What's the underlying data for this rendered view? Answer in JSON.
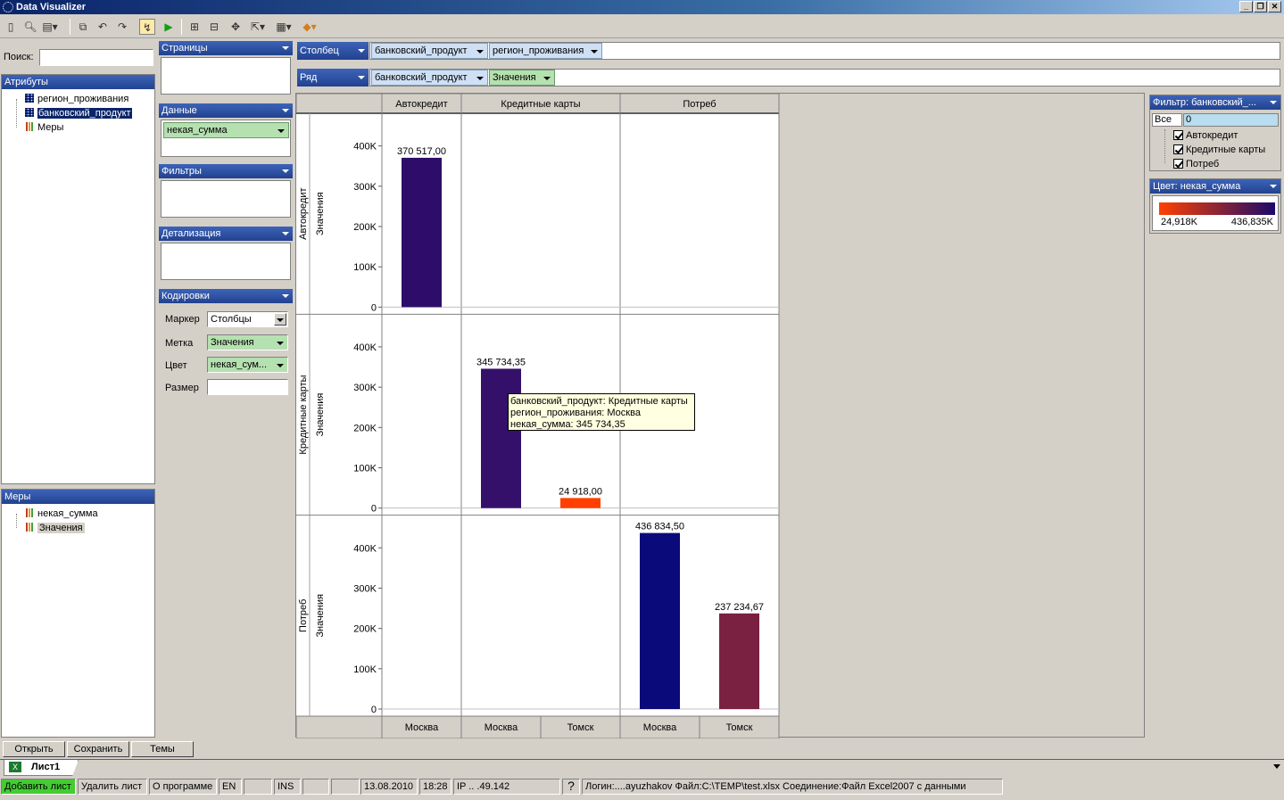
{
  "window": {
    "title": "Data Visualizer",
    "btn_min": "_",
    "btn_max": "❐",
    "btn_close": "✕"
  },
  "toolbar": {
    "icons": [
      "new-icon",
      "preview-icon",
      "export-icon",
      "copy-icon",
      "undo-icon",
      "redo-icon",
      "highlight-icon",
      "run-icon",
      "layout-icon",
      "swap-icon",
      "fit-icon",
      "export2-icon",
      "chart-type-icon",
      "color-icon"
    ]
  },
  "left": {
    "search_label": "Поиск:",
    "search_value": "",
    "attributes_title": "Атрибуты",
    "attributes": [
      "регион_проживания",
      "банковский_продукт",
      "Меры"
    ],
    "measures_title": "Меры",
    "measures": [
      "некая_сумма",
      "Значения"
    ]
  },
  "shelves": {
    "pages": "Страницы",
    "data": "Данные",
    "data_pill": "некая_сумма",
    "filters": "Фильтры",
    "detail": "Детализация",
    "encodings": "Кодировки",
    "marker_label": "Маркер",
    "marker_value": "Столбцы",
    "label_label": "Метка",
    "label_value": "Значения",
    "color_label": "Цвет",
    "color_value": "некая_сум...",
    "size_label": "Размер",
    "size_value": ""
  },
  "columns_shelf": {
    "title": "Столбец",
    "pills": [
      "банковский_продукт",
      "регион_проживания"
    ]
  },
  "rows_shelf": {
    "title": "Ряд",
    "pills": [
      "банковский_продукт",
      "Значения"
    ]
  },
  "filter_panel": {
    "title": "Фильтр: банковский_...",
    "all_label": "Все",
    "all_value": "0",
    "items": [
      "Автокредит",
      "Кредитные карты",
      "Потреб"
    ]
  },
  "color_panel": {
    "title": "Цвет: некая_сумма",
    "min_label": "24,918K",
    "max_label": "436,835K",
    "min_color": "#ff4000",
    "max_color": "#1a0a6a"
  },
  "tooltip": {
    "line1": "банковский_продукт: Кредитные карты",
    "line2": "регион_проживания: Москва",
    "line3": "некая_сумма: 345 734,35"
  },
  "chart_data": {
    "type": "bar",
    "column_groups": [
      "Автокредит",
      "Кредитные карты",
      "Потреб"
    ],
    "row_groups": [
      "Автокредит",
      "Кредитные карты",
      "Потреб"
    ],
    "row_axis_label": "Значения",
    "regions_per_column": [
      [
        "Москва"
      ],
      [
        "Москва",
        "Томск"
      ],
      [
        "Москва",
        "Томск"
      ]
    ],
    "ylim": [
      0,
      450000
    ],
    "yticks": [
      "0",
      "100K",
      "200K",
      "300K",
      "400K"
    ],
    "series": [
      {
        "row": "Автокредит",
        "column": "Автокредит",
        "region": "Москва",
        "value": 370517.0,
        "label": "370 517,00",
        "color": "#2e0d6a"
      },
      {
        "row": "Кредитные карты",
        "column": "Кредитные карты",
        "region": "Москва",
        "value": 345734.35,
        "label": "345 734,35",
        "color": "#34106a"
      },
      {
        "row": "Кредитные карты",
        "column": "Кредитные карты",
        "region": "Томск",
        "value": 24918.0,
        "label": "24 918,00",
        "color": "#ff4000"
      },
      {
        "row": "Потреб",
        "column": "Потреб",
        "region": "Москва",
        "value": 436834.5,
        "label": "436 834,50",
        "color": "#0a0a7a"
      },
      {
        "row": "Потреб",
        "column": "Потреб",
        "region": "Томск",
        "value": 237234.67,
        "label": "237 234,67",
        "color": "#7a2040"
      }
    ]
  },
  "bottom_buttons": {
    "open": "Открыть",
    "save": "Сохранить",
    "themes": "Темы"
  },
  "sheet_tab": "Лист1",
  "status": {
    "add_sheet": "Добавить лист",
    "delete_sheet": "Удалить лист",
    "about": "О программе",
    "lang": "EN",
    "ins": "INS",
    "date": "13.08.2010",
    "time": "18:28",
    "ip": "IP .. .49.142",
    "help": "?",
    "info": "Логин:....ayuzhakov  Файл:C:\\TEMP\\test.xlsx   Соединение:Файл Excel2007 с данными"
  }
}
